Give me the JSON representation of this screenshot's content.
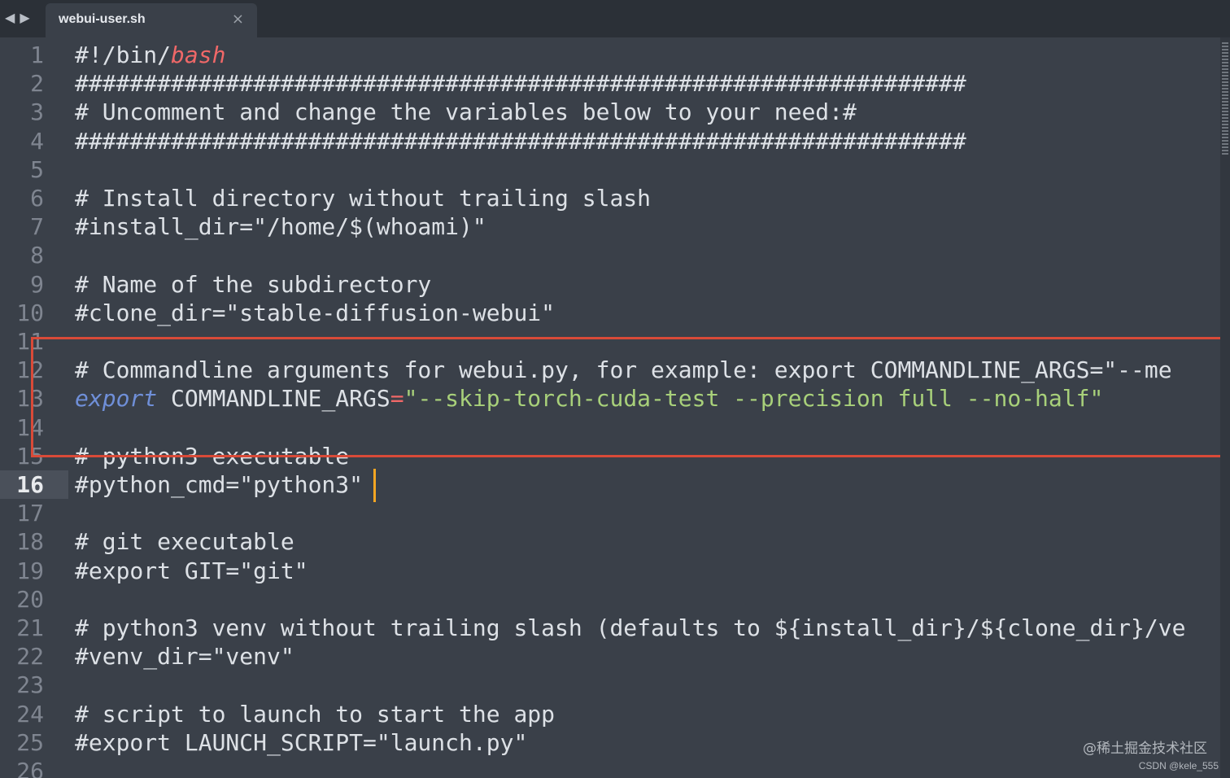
{
  "tab": {
    "title": "webui-user.sh",
    "close": "×"
  },
  "nav": {
    "back": "◀",
    "forward": "▶"
  },
  "editor": {
    "current_line": 16,
    "lines": [
      {
        "n": "1",
        "t": "#!/bin/"
      },
      {
        "n": "2",
        "t": "#################################################################"
      },
      {
        "n": "3",
        "t": "# Uncomment and change the variables below to your need:#"
      },
      {
        "n": "4",
        "t": "#################################################################"
      },
      {
        "n": "5",
        "t": ""
      },
      {
        "n": "6",
        "t": "# Install directory without trailing slash"
      },
      {
        "n": "7",
        "t": "#install_dir=\"/home/$(whoami)\""
      },
      {
        "n": "8",
        "t": ""
      },
      {
        "n": "9",
        "t": "# Name of the subdirectory"
      },
      {
        "n": "10",
        "t": "#clone_dir=\"stable-diffusion-webui\""
      },
      {
        "n": "11",
        "t": ""
      },
      {
        "n": "12",
        "t": "# Commandline arguments for webui.py, for example: export COMMANDLINE_ARGS=\"--me"
      },
      {
        "n": "13",
        "t": ""
      },
      {
        "n": "14",
        "t": ""
      },
      {
        "n": "15",
        "t": "# python3 executable"
      },
      {
        "n": "16",
        "t": "#python_cmd=\"python3\""
      },
      {
        "n": "17",
        "t": ""
      },
      {
        "n": "18",
        "t": "# git executable"
      },
      {
        "n": "19",
        "t": "#export GIT=\"git\""
      },
      {
        "n": "20",
        "t": ""
      },
      {
        "n": "21",
        "t": "# python3 venv without trailing slash (defaults to ${install_dir}/${clone_dir}/ve"
      },
      {
        "n": "22",
        "t": "#venv_dir=\"venv\""
      },
      {
        "n": "23",
        "t": ""
      },
      {
        "n": "24",
        "t": "# script to launch to start the app"
      },
      {
        "n": "25",
        "t": "#export LAUNCH_SCRIPT=\"launch.py\""
      },
      {
        "n": "26",
        "t": ""
      }
    ],
    "line1_shell": "bash",
    "line13": {
      "keyword": "export",
      "name": " COMMANDLINE_ARGS",
      "eq": "=",
      "value": "\"--skip-torch-cuda-test --precision full --no-half\""
    }
  },
  "watermark": {
    "line1": "@稀土掘金技术社区",
    "line2": "CSDN @kele_555"
  },
  "colors": {
    "highlight_box": "#d94a38",
    "cursor": "#f5a623"
  }
}
